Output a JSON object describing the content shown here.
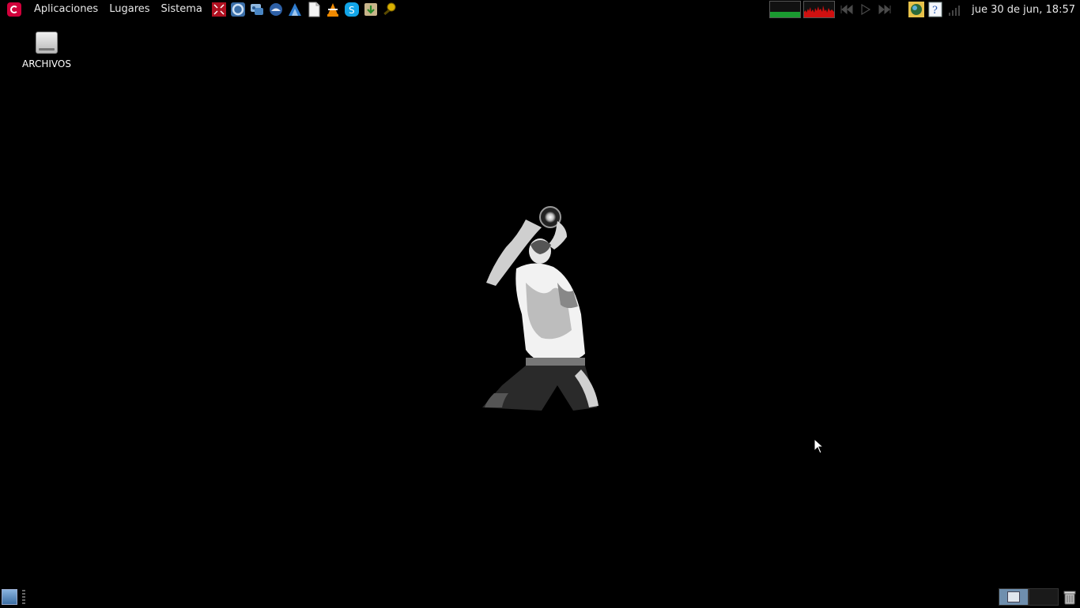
{
  "top_panel": {
    "menus": [
      "Aplicaciones",
      "Lugares",
      "Sistema"
    ],
    "launchers": [
      "screenshot-icon",
      "chromium-icon",
      "im-messenger-icon",
      "thunderbird-icon",
      "text-editor-icon",
      "new-document-icon",
      "vlc-icon",
      "skype-icon",
      "download-manager-icon",
      "search-tool-icon"
    ],
    "monitors": [
      "cpu-monitor",
      "network-monitor"
    ],
    "media_controls": [
      "previous-icon",
      "play-icon",
      "next-icon"
    ],
    "tray": [
      "weather-icon",
      "help-icon",
      "signal-icon"
    ],
    "clock": "jue 30 de jun, 18:57"
  },
  "desktop": {
    "icons": [
      {
        "label": "ARCHIVOS",
        "icon": "drive-icon"
      }
    ]
  },
  "bottom_panel": {
    "show_desktop_icon": "show-desktop-icon",
    "workspaces": 2,
    "active_workspace": 1,
    "trash_icon": "trash-icon"
  },
  "colors": {
    "background": "#000000",
    "cpu_graph": "#1a9a30",
    "net_graph": "#d01010",
    "debian_red": "#d1003b"
  }
}
